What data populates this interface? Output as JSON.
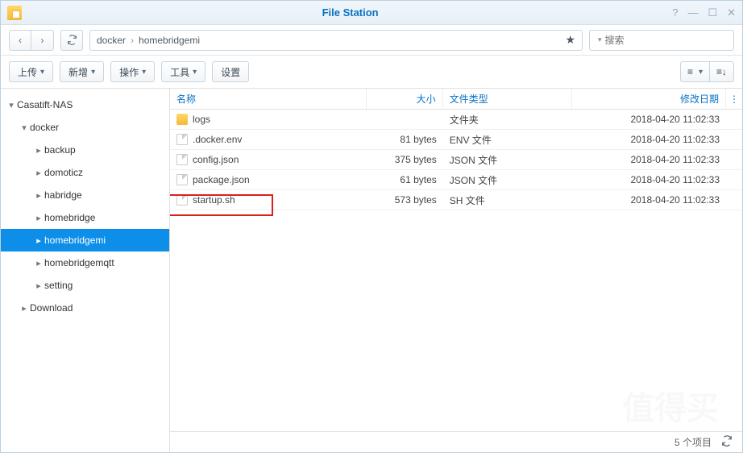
{
  "title": "File Station",
  "breadcrumb": {
    "seg1": "docker",
    "seg2": "homebridgemi"
  },
  "search": {
    "placeholder": "搜索"
  },
  "toolbar": {
    "upload": "上传",
    "create": "新增",
    "action": "操作",
    "tool": "工具",
    "settings": "设置"
  },
  "columns": {
    "name": "名称",
    "size": "大小",
    "type": "文件类型",
    "date": "修改日期"
  },
  "tree": {
    "root": "Casatift-NAS",
    "n1": "docker",
    "items": {
      "i0": "backup",
      "i1": "domoticz",
      "i2": "habridge",
      "i3": "homebridge",
      "i4": "homebridgemi",
      "i5": "homebridgemqtt",
      "i6": "setting"
    },
    "n2": "Download"
  },
  "rows": [
    {
      "name": "logs",
      "size": "",
      "type": "文件夹",
      "date": "2018-04-20 11:02:33",
      "icon": "folder"
    },
    {
      "name": ".docker.env",
      "size": "81 bytes",
      "type": "ENV 文件",
      "date": "2018-04-20 11:02:33",
      "icon": "file"
    },
    {
      "name": "config.json",
      "size": "375 bytes",
      "type": "JSON 文件",
      "date": "2018-04-20 11:02:33",
      "icon": "file"
    },
    {
      "name": "package.json",
      "size": "61 bytes",
      "type": "JSON 文件",
      "date": "2018-04-20 11:02:33",
      "icon": "file"
    },
    {
      "name": "startup.sh",
      "size": "573 bytes",
      "type": "SH 文件",
      "date": "2018-04-20 11:02:33",
      "icon": "file",
      "highlight": true
    }
  ],
  "status": {
    "count": "5 个项目"
  },
  "watermark": "值得买"
}
